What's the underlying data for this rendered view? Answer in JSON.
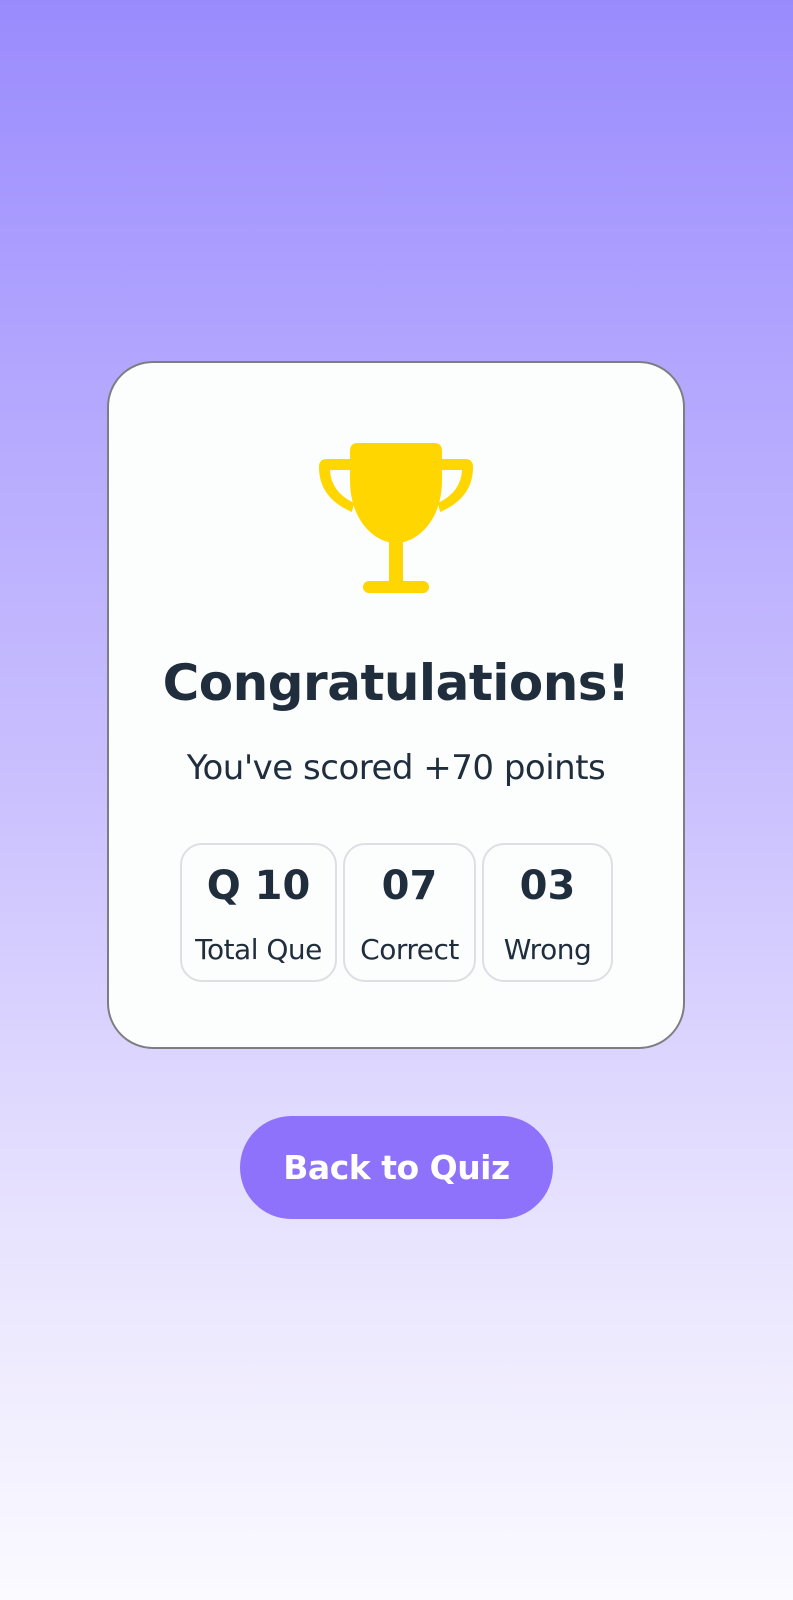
{
  "result_card": {
    "trophy_icon": "trophy-icon",
    "trophy_color": "#ffd600",
    "title": "Congratulations!",
    "subtitle": "You've scored +70 points"
  },
  "stats": [
    {
      "value": "Q 10",
      "label": "Total Que"
    },
    {
      "value": "07",
      "label": "Correct"
    },
    {
      "value": "03",
      "label": "Wrong"
    }
  ],
  "actions": {
    "back_label": "Back to Quiz"
  },
  "colors": {
    "accent": "#8e72fc",
    "text": "#1f2d3d",
    "card_background": "#fcfdfd"
  }
}
